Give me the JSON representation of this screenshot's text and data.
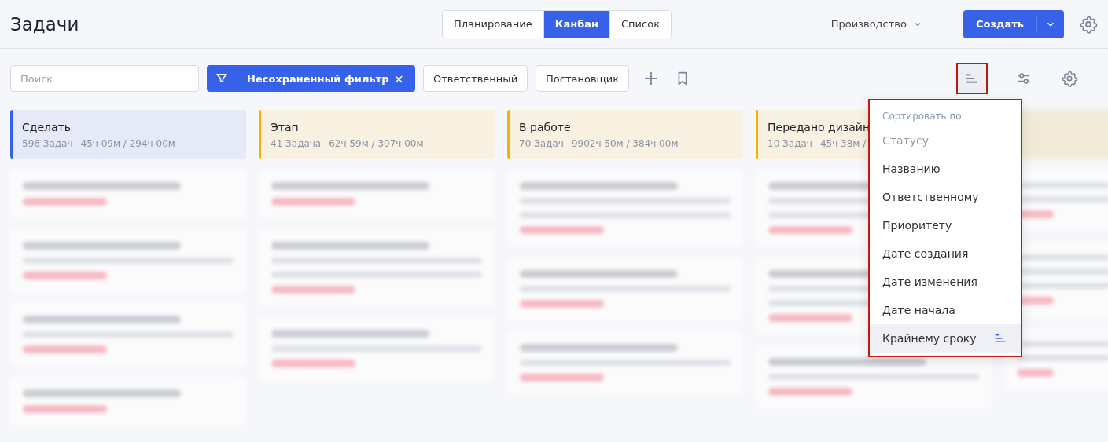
{
  "page_title": "Задачи",
  "view_tabs": [
    {
      "label": "Планирование",
      "selected": false
    },
    {
      "label": "Канбан",
      "selected": true
    },
    {
      "label": "Список",
      "selected": false
    }
  ],
  "project_selector": {
    "label": "Производство"
  },
  "create_button": {
    "label": "Создать"
  },
  "search": {
    "placeholder": "Поиск"
  },
  "active_filter": {
    "label": "Несохраненный фильтр",
    "close": "×"
  },
  "filter_buttons": [
    "Ответственный",
    "Постановщик"
  ],
  "columns": [
    {
      "title": "Сделать",
      "count": "596 Задач",
      "time": "45ч 09м / 294ч 00м",
      "color": "#3661e8"
    },
    {
      "title": "Этап",
      "count": "41 Задача",
      "time": "62ч 59м / 397ч 00м",
      "color": "#f5b000"
    },
    {
      "title": "В работе",
      "count": "70 Задач",
      "time": "9902ч 50м / 384ч 00м",
      "color": "#f5b000"
    },
    {
      "title": "Передано дизайн",
      "count": "10 Задач",
      "time": "45ч 38м /",
      "color": "#f5b000"
    }
  ],
  "sort_menu": {
    "title": "Сортировать по",
    "items": [
      {
        "label": "Статусу",
        "disabled": true,
        "selected": false
      },
      {
        "label": "Названию",
        "disabled": false,
        "selected": false
      },
      {
        "label": "Ответственному",
        "disabled": false,
        "selected": false
      },
      {
        "label": "Приоритету",
        "disabled": false,
        "selected": false
      },
      {
        "label": "Дате создания",
        "disabled": false,
        "selected": false
      },
      {
        "label": "Дате изменения",
        "disabled": false,
        "selected": false
      },
      {
        "label": "Дате начала",
        "disabled": false,
        "selected": false
      },
      {
        "label": "Крайнему сроку",
        "disabled": false,
        "selected": true
      }
    ]
  }
}
